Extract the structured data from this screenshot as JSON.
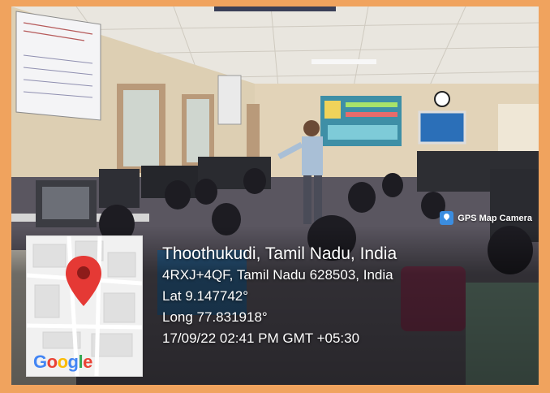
{
  "camera_badge": {
    "label": "GPS Map Camera",
    "icon": "map-pin-icon"
  },
  "location": {
    "title": "Thoothukudi, Tamil Nadu, India",
    "address": "4RXJ+4QF, Tamil Nadu 628503, India",
    "lat": "Lat 9.147742°",
    "long": "Long 77.831918°",
    "datetime": "17/09/22 02:41 PM GMT +05:30"
  },
  "map": {
    "brand": [
      "G",
      "o",
      "o",
      "g",
      "l",
      "e"
    ],
    "pin_color": "#e53935"
  },
  "colors": {
    "frame": "#f0a35e"
  }
}
